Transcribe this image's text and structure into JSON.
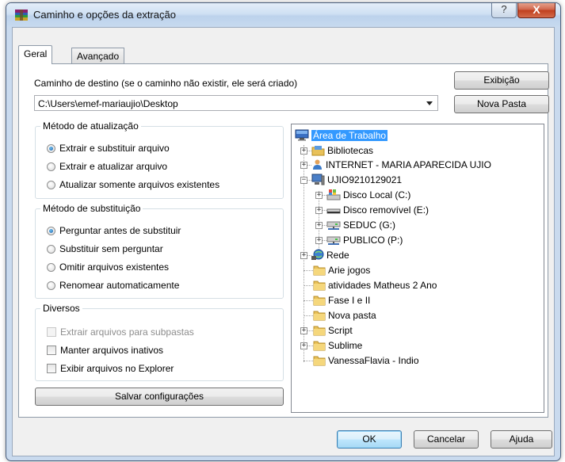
{
  "window": {
    "title": "Caminho e opções da extração",
    "help": "?",
    "close": "X"
  },
  "tabs": [
    {
      "label": "Geral"
    },
    {
      "label": "Avançado"
    }
  ],
  "destination": {
    "label": "Caminho de destino (se o caminho não existir, ele será criado)",
    "value": "C:\\Users\\emef-mariaujio\\Desktop",
    "view_button": "Exibição",
    "new_folder_button": "Nova Pasta"
  },
  "update_method": {
    "title": "Método de atualização",
    "options": [
      {
        "label": "Extrair e substituir arquivo",
        "checked": true
      },
      {
        "label": "Extrair e atualizar arquivo",
        "checked": false
      },
      {
        "label": "Atualizar somente arquivos existentes",
        "checked": false
      }
    ]
  },
  "overwrite_method": {
    "title": "Método de substituição",
    "options": [
      {
        "label": "Perguntar antes de substituir",
        "checked": true
      },
      {
        "label": "Substituir sem perguntar",
        "checked": false
      },
      {
        "label": "Omitir arquivos existentes",
        "checked": false
      },
      {
        "label": "Renomear automaticamente",
        "checked": false
      }
    ]
  },
  "misc": {
    "title": "Diversos",
    "options": [
      {
        "label": "Extrair arquivos para subpastas",
        "checked": false,
        "disabled": true
      },
      {
        "label": "Manter arquivos inativos",
        "checked": false,
        "disabled": false
      },
      {
        "label": "Exibir arquivos no Explorer",
        "checked": false,
        "disabled": false
      }
    ]
  },
  "save_button": "Salvar configurações",
  "tree": {
    "root": "Área de Trabalho",
    "items": [
      "Bibliotecas",
      "INTERNET - MARIA APARECIDA UJIO",
      "UJIO9210129021",
      "Disco Local (C:)",
      "Disco removível (E:)",
      "SEDUC (G:)",
      "PUBLICO (P:)",
      "Rede",
      "Arie jogos",
      "atividades Matheus 2 Ano",
      "Fase I e II",
      "Nova pasta",
      "Script",
      "Sublime",
      "VanessaFlavia - Indio"
    ]
  },
  "footer": {
    "ok": "OK",
    "cancel": "Cancelar",
    "help": "Ajuda"
  }
}
